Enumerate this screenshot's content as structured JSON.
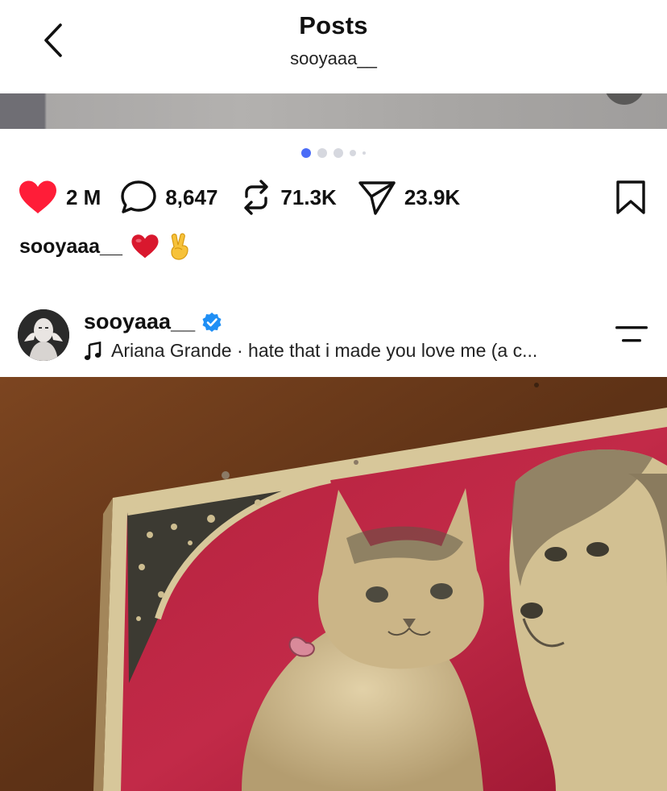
{
  "header": {
    "title": "Posts",
    "subtitle": "sooyaaa__",
    "back_icon": "chevron-left-icon"
  },
  "carousel": {
    "dot_count": 5,
    "active_index": 0,
    "active_color": "#4a6cf7"
  },
  "actions": {
    "likes": "2 M",
    "comments": "8,647",
    "reposts": "71.3K",
    "shares": "23.9K",
    "like_color": "#ff1d38",
    "icons": [
      "heart-icon",
      "comment-icon",
      "repost-icon",
      "share-icon",
      "bookmark-icon"
    ]
  },
  "caption": {
    "username": "sooyaaa__",
    "emojis": [
      "red-heart",
      "victory-hand"
    ]
  },
  "next_post": {
    "username": "sooyaaa__",
    "verified": true,
    "verified_color": "#1f8ff5",
    "music": "Ariana Grande · hate that i made you love me (a c..."
  }
}
